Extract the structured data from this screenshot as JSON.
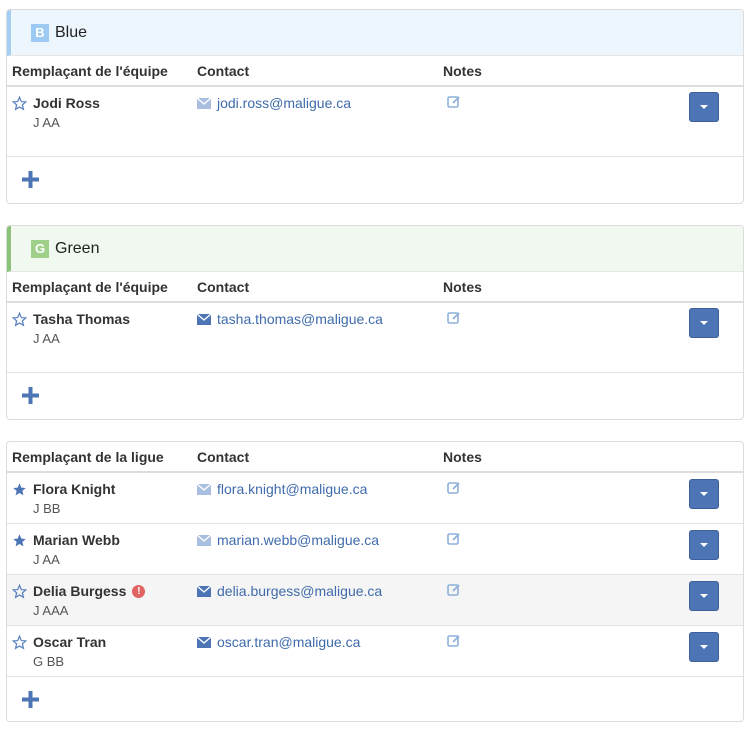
{
  "headers": {
    "team_substitute": "Remplaçant de l'équipe",
    "league_substitute": "Remplaçant de la ligue",
    "contact": "Contact",
    "notes": "Notes"
  },
  "teams": [
    {
      "letter": "B",
      "name": "Blue",
      "color": "#9ccaf3",
      "players": [
        {
          "name": "Jodi Ross",
          "level": "J AA",
          "email": "jodi.ross@maligue.ca",
          "starred": false
        }
      ]
    },
    {
      "letter": "G",
      "name": "Green",
      "color": "#9ed08a",
      "players": [
        {
          "name": "Tasha Thomas",
          "level": "J AA",
          "email": "tasha.thomas@maligue.ca",
          "starred": false
        }
      ]
    }
  ],
  "league": {
    "players": [
      {
        "name": "Flora Knight",
        "level": "J BB",
        "email": "flora.knight@maligue.ca",
        "starred": true
      },
      {
        "name": "Marian Webb",
        "level": "J AA",
        "email": "marian.webb@maligue.ca",
        "starred": true
      },
      {
        "name": "Delia Burgess",
        "level": "J AAA",
        "email": "delia.burgess@maligue.ca",
        "starred": false,
        "warning": "!"
      },
      {
        "name": "Oscar Tran",
        "level": "G BB",
        "email": "oscar.tran@maligue.ca",
        "starred": false
      }
    ]
  },
  "colors": {
    "accent": "#4d74b5",
    "link": "#3f6bac",
    "warning": "#e06464"
  }
}
